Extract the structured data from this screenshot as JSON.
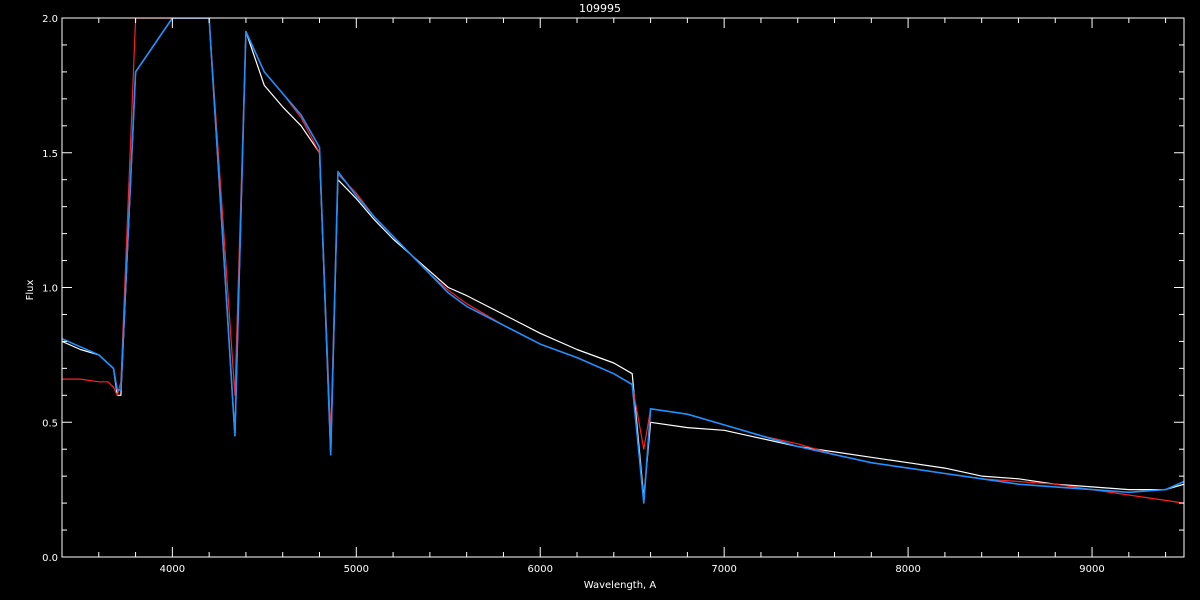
{
  "chart_data": {
    "type": "line",
    "title": "109995",
    "xlabel": "Wavelength, A",
    "ylabel": "Flux",
    "xlim": [
      3400,
      9500
    ],
    "ylim": [
      0.0,
      2.0
    ],
    "x_ticks": [
      4000,
      5000,
      6000,
      7000,
      8000,
      9000
    ],
    "y_ticks": [
      0.0,
      0.5,
      1.0,
      1.5,
      2.0
    ],
    "x_tick_labels": [
      "4000",
      "5000",
      "6000",
      "7000",
      "8000",
      "9000"
    ],
    "y_tick_labels": [
      "0.0",
      "0.5",
      "1.0",
      "1.5",
      "2.0"
    ],
    "x_minor_step": 200,
    "y_minor_step": 0.1,
    "grid": false,
    "legend": "none",
    "background": "#000000",
    "axis_color": "#ffffff",
    "series": [
      {
        "color": "#ffffff",
        "style": "observed-white",
        "x": [
          3400,
          3500,
          3600,
          3680,
          3700,
          3720,
          3800,
          4000,
          4200,
          4340,
          4400,
          4500,
          4600,
          4700,
          4800,
          4861,
          4900,
          5000,
          5100,
          5200,
          5300,
          5400,
          5500,
          5600,
          5800,
          6000,
          6200,
          6400,
          6500,
          6563,
          6600,
          6800,
          7000,
          7200,
          7400,
          7600,
          7800,
          8000,
          8200,
          8400,
          8600,
          8800,
          9000,
          9200,
          9400,
          9500
        ],
        "y": [
          0.8,
          0.77,
          0.75,
          0.7,
          0.6,
          0.6,
          1.8,
          2.0,
          2.0,
          0.45,
          1.95,
          1.75,
          1.67,
          1.6,
          1.5,
          0.38,
          1.4,
          1.33,
          1.25,
          1.18,
          1.12,
          1.06,
          1.0,
          0.97,
          0.9,
          0.83,
          0.77,
          0.72,
          0.68,
          0.22,
          0.5,
          0.48,
          0.47,
          0.44,
          0.41,
          0.39,
          0.37,
          0.35,
          0.33,
          0.3,
          0.29,
          0.27,
          0.26,
          0.25,
          0.25,
          0.27
        ]
      },
      {
        "color": "#ff2020",
        "style": "model-red",
        "x": [
          3400,
          3500,
          3600,
          3650,
          3680,
          3700,
          3720,
          3800,
          4000,
          4200,
          4340,
          4400,
          4500,
          4600,
          4700,
          4800,
          4861,
          4900,
          5000,
          5100,
          5200,
          5300,
          5400,
          5500,
          5600,
          5800,
          6000,
          6200,
          6400,
          6500,
          6563,
          6600,
          6800,
          7000,
          7200,
          7400,
          7600,
          7800,
          8000,
          8200,
          8400,
          8600,
          8800,
          9000,
          9200,
          9400,
          9500
        ],
        "y": [
          0.66,
          0.66,
          0.65,
          0.65,
          0.63,
          0.6,
          0.65,
          2.0,
          2.0,
          2.0,
          0.6,
          1.95,
          1.8,
          1.72,
          1.63,
          1.5,
          0.45,
          1.42,
          1.35,
          1.26,
          1.19,
          1.12,
          1.05,
          0.99,
          0.94,
          0.86,
          0.79,
          0.74,
          0.68,
          0.64,
          0.4,
          0.55,
          0.53,
          0.49,
          0.45,
          0.42,
          0.38,
          0.35,
          0.33,
          0.31,
          0.29,
          0.28,
          0.27,
          0.25,
          0.23,
          0.21,
          0.2
        ]
      },
      {
        "color": "#1e90ff",
        "style": "observed-blue",
        "x": [
          3400,
          3500,
          3600,
          3680,
          3700,
          3720,
          3800,
          4000,
          4200,
          4340,
          4400,
          4500,
          4600,
          4700,
          4800,
          4861,
          4900,
          5000,
          5100,
          5200,
          5300,
          5400,
          5500,
          5600,
          5800,
          6000,
          6200,
          6400,
          6500,
          6563,
          6600,
          6800,
          7000,
          7200,
          7400,
          7600,
          7800,
          8000,
          8200,
          8400,
          8600,
          8800,
          9000,
          9200,
          9400,
          9500
        ],
        "y": [
          0.81,
          0.78,
          0.75,
          0.7,
          0.62,
          0.62,
          1.8,
          2.0,
          2.0,
          0.45,
          1.95,
          1.8,
          1.72,
          1.64,
          1.52,
          0.38,
          1.43,
          1.34,
          1.26,
          1.19,
          1.12,
          1.05,
          0.98,
          0.93,
          0.86,
          0.79,
          0.74,
          0.68,
          0.64,
          0.2,
          0.55,
          0.53,
          0.49,
          0.45,
          0.41,
          0.38,
          0.35,
          0.33,
          0.31,
          0.29,
          0.27,
          0.26,
          0.25,
          0.24,
          0.25,
          0.28
        ]
      }
    ]
  }
}
